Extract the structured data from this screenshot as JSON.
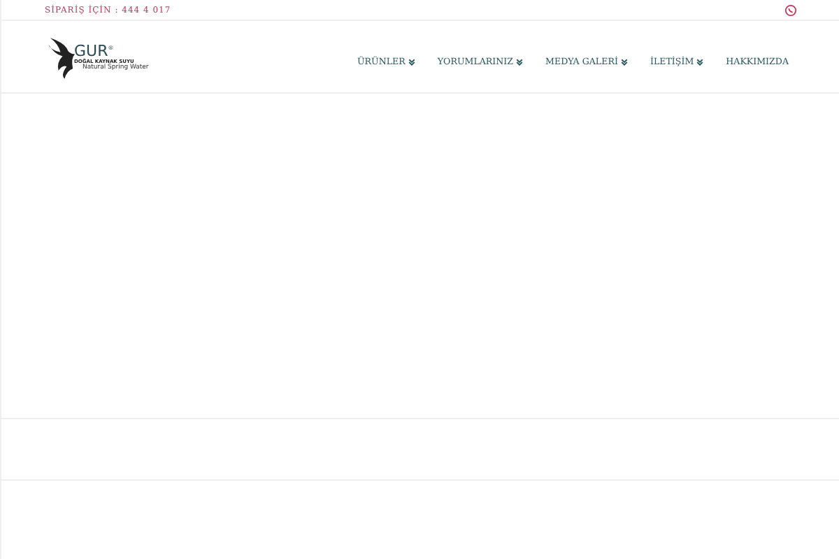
{
  "topbar": {
    "phone": "SİPARİŞ İÇİN : 444 4 017"
  },
  "logo": {
    "name": "GUR",
    "mark": "®",
    "tagline": "DOĞAL KAYNAK SUYU",
    "subtitle": "Natural Spring Water"
  },
  "nav": [
    {
      "label": "ÜRÜNLER",
      "dropdown": true
    },
    {
      "label": "YORUMLARINIZ",
      "dropdown": true
    },
    {
      "label": "MEDYA GALERİ",
      "dropdown": true
    },
    {
      "label": "İLETİŞİM",
      "dropdown": true
    },
    {
      "label": "HAKKIMIZDA",
      "dropdown": false
    }
  ]
}
